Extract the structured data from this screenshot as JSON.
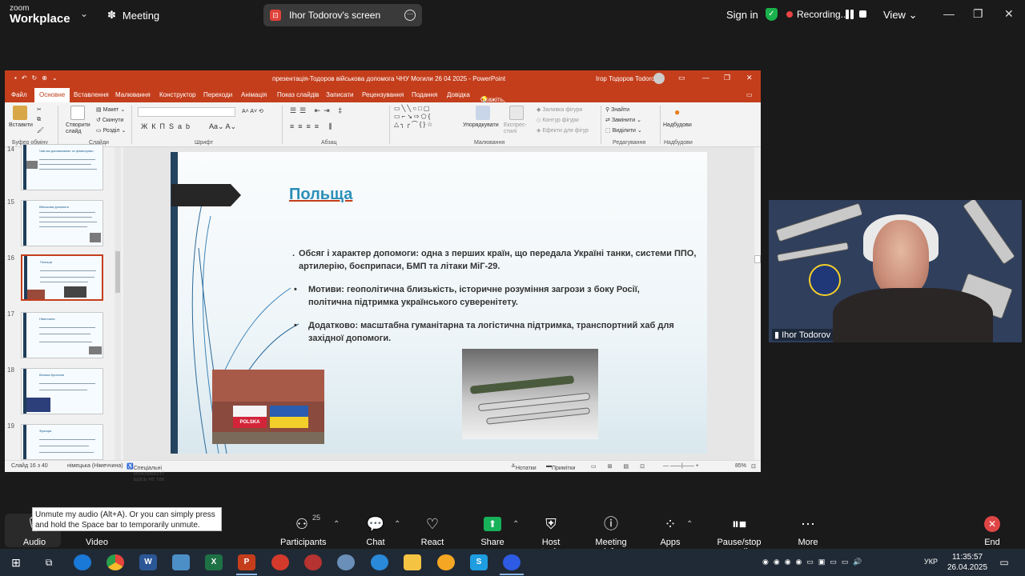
{
  "zoom": {
    "logo_line1": "zoom",
    "logo_line2": "Workplace",
    "meeting_label": "Meeting",
    "screen_share_label": "Ihor Todorov's screen",
    "sign_in": "Sign in",
    "recording_label": "Recording...",
    "view_label": "View",
    "accent": "#17b15a",
    "record_color": "#e94545"
  },
  "ppt": {
    "document_title": "презентація-Тодоров військова допомога ЧНУ Могили 26 04 2025  -  PowerPoint",
    "user_name": "Ігор Тодоров Todorov",
    "tabs": [
      "Файл",
      "Основне",
      "Вставлення",
      "Малювання",
      "Конструктор",
      "Переходи",
      "Анімація",
      "Показ слайдів",
      "Записати",
      "Рецензування",
      "Подання",
      "Довідка"
    ],
    "tell_me": "Скажіть, що потрібно зробити",
    "ribbon": {
      "paste": "Вставити",
      "new_slide": "Створити слайд",
      "layout": "Макет",
      "reset": "Скинути",
      "section": "Розділ",
      "find": "Знайти",
      "replace": "Замінити",
      "select": "Виділити",
      "arrange": "Упорядкувати",
      "quick_styles": "Експрес-стилі",
      "shape_fill": "Заливка фігури",
      "shape_outline": "Контур фігури",
      "shape_effects": "Ефекти для фігур",
      "addins": "Надбудови",
      "groups": [
        "Буфер обміну",
        "Слайди",
        "Шрифт",
        "Абзац",
        "Малювання",
        "Редагування",
        "Надбудови"
      ]
    },
    "thumb_numbers": [
      "14",
      "15",
      "16",
      "17",
      "18",
      "19"
    ],
    "thumb_titles": [
      "Чим ми допомагаємо та фінансуємо",
      "Військова допомога",
      "Польща",
      "Німеччина",
      "Велика Британія",
      "Франція"
    ],
    "slide": {
      "title": "Польща",
      "bullets": [
        {
          "marker": ".",
          "text": "Обсяг і характер допомоги: одна з перших країн, що передала Україні танки, системи ППО, артилерію, боєприпаси, БМП та літаки МіГ-29."
        },
        {
          "marker": "•",
          "text": "Мотиви: геополітична близькість, історичне розуміння загрози з боку Росії, політична підтримка українського суверенітету."
        },
        {
          "marker": "•",
          "text": "Додатково: масштабна гуманітарна та логістична підтримка, транспортний хаб для західної допомоги."
        }
      ],
      "photo1_caption": "POLSKA"
    },
    "status": {
      "slide_counter": "Слайд 16 з 40",
      "language": "німецька (Німеччина)",
      "accessibility": "Спеціальні можливості: щось не так",
      "notes": "Нотатки",
      "comments": "Примітки",
      "zoom_level": "85%"
    }
  },
  "video": {
    "participant_name": "Ihor Todorov"
  },
  "tooltip": {
    "text": "Unmute my audio (Alt+A). Or you can simply press and hold the Space bar to temporarily unmute."
  },
  "toolbar": {
    "audio": "Audio",
    "video": "Video",
    "participants": "Participants",
    "participants_count": "25",
    "chat": "Chat",
    "react": "React",
    "share": "Share",
    "host_tools": "Host tools",
    "meeting_info": "Meeting info",
    "apps": "Apps",
    "pause_stop": "Pause/stop recording",
    "more": "More",
    "end": "End"
  },
  "taskbar": {
    "language": "УКР",
    "time": "11:35:57",
    "date": "26.04.2025"
  }
}
